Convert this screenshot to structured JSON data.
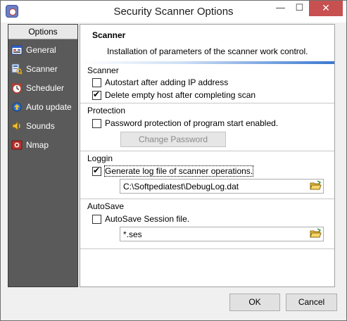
{
  "window": {
    "title": "Security Scanner Options",
    "controls": {
      "minimize": "—",
      "maximize": "☐",
      "close": "✕"
    }
  },
  "sidebar": {
    "header": "Options",
    "items": [
      {
        "label": "General",
        "icon": "general-icon"
      },
      {
        "label": "Scanner",
        "icon": "scanner-icon"
      },
      {
        "label": "Scheduler",
        "icon": "clock-icon"
      },
      {
        "label": "Auto update",
        "icon": "update-icon"
      },
      {
        "label": "Sounds",
        "icon": "speaker-icon"
      },
      {
        "label": "Nmap",
        "icon": "nmap-icon"
      }
    ]
  },
  "main": {
    "title": "Scanner",
    "description": "Installation of parameters of the scanner work control.",
    "groups": {
      "scanner": {
        "title": "Scanner",
        "autostart": {
          "label": "Autostart after adding IP address",
          "checked": false
        },
        "delete_empty": {
          "label": "Delete empty host after completing scan",
          "checked": true
        }
      },
      "protection": {
        "title": "Protection",
        "password": {
          "label": "Password protection of program start enabled.",
          "checked": false
        },
        "change_password_label": "Change Password"
      },
      "logging": {
        "title": "Loggin",
        "generate_log": {
          "label": "Generate log file of scanner operations.",
          "checked": true
        },
        "log_path": "C:\\Softpediatest\\DebugLog.dat"
      },
      "autosave": {
        "title": "AutoSave",
        "session": {
          "label": "AutoSave Session file.",
          "checked": false
        },
        "session_path": "*.ses"
      }
    }
  },
  "footer": {
    "ok_label": "OK",
    "cancel_label": "Cancel"
  }
}
